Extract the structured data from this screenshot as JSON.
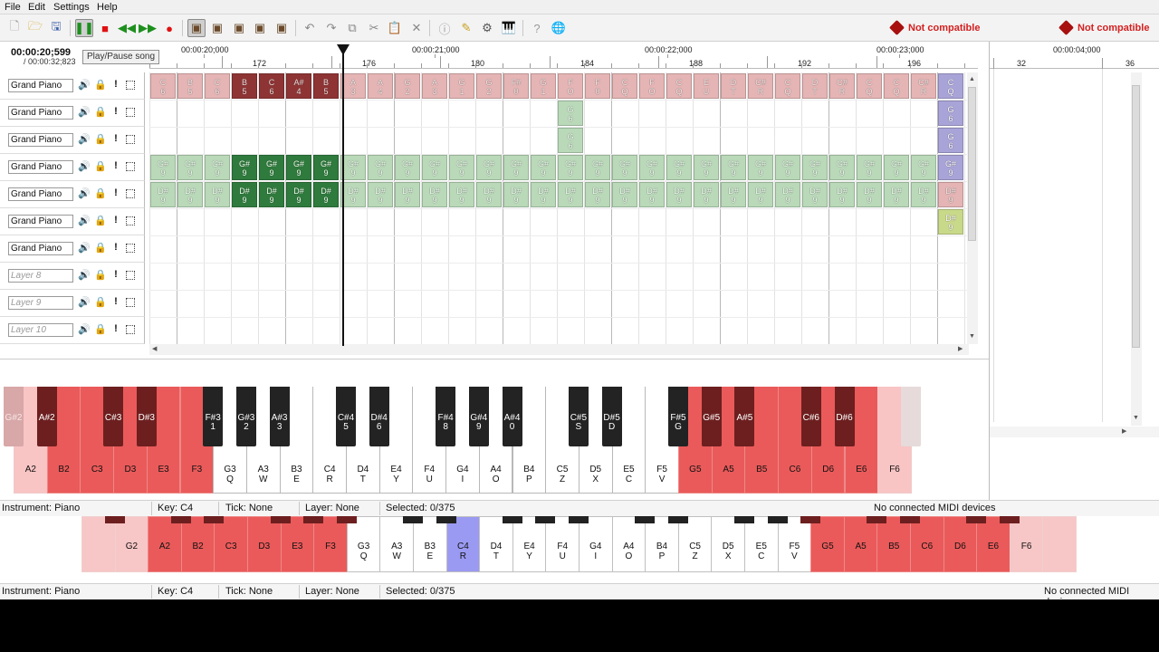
{
  "menu": [
    "File",
    "Edit",
    "Settings",
    "Help"
  ],
  "toolbar": {
    "not_compatible": "Not compatible",
    "tooltip": "Play/Pause song"
  },
  "time": {
    "current": "00:00:20;599",
    "total": "/ 00:00:32;823"
  },
  "ruler": {
    "times": [
      "00:00:20;000",
      "00:00:21;000",
      "00:00:22;000",
      "00:00:23;000"
    ],
    "ticks": [
      "172",
      "176",
      "180",
      "184",
      "188",
      "192",
      "196"
    ],
    "right_time": "00:00:04;000",
    "right_ticks": [
      "32",
      "36"
    ]
  },
  "layers": [
    {
      "name": "Grand Piano",
      "dim": false
    },
    {
      "name": "Grand Piano",
      "dim": false
    },
    {
      "name": "Grand Piano",
      "dim": false
    },
    {
      "name": "Grand Piano",
      "dim": false
    },
    {
      "name": "Grand Piano",
      "dim": false
    },
    {
      "name": "Grand Piano",
      "dim": false
    },
    {
      "name": "Grand Piano",
      "dim": false
    },
    {
      "name": "Layer 8",
      "dim": true
    },
    {
      "name": "Layer 9",
      "dim": true
    },
    {
      "name": "Layer 10",
      "dim": true
    }
  ],
  "notes_row1": [
    [
      "C",
      "6"
    ],
    [
      "B",
      "5"
    ],
    [
      "C",
      "6"
    ],
    [
      "B",
      "5"
    ],
    [
      "C",
      "6"
    ],
    [
      "A#",
      "4"
    ],
    [
      "B",
      "5"
    ],
    [
      "A",
      "3"
    ],
    [
      "A",
      "4"
    ],
    [
      "G",
      "2"
    ],
    [
      "A",
      "3"
    ],
    [
      "G",
      "1"
    ],
    [
      "G",
      "2"
    ],
    [
      "F#",
      "0"
    ],
    [
      "G",
      "1"
    ],
    [
      "F",
      "O"
    ],
    [
      "F",
      "0"
    ],
    [
      "C",
      "Q"
    ],
    [
      "F",
      "O"
    ],
    [
      "C",
      "Q"
    ],
    [
      "E",
      "U"
    ],
    [
      "D",
      "T"
    ],
    [
      "C#",
      "R"
    ],
    [
      "C",
      "Q"
    ],
    [
      "D",
      "T"
    ],
    [
      "C#",
      "R"
    ],
    [
      "C",
      "Q"
    ],
    [
      "C",
      "Q"
    ],
    [
      "C#",
      "R"
    ],
    [
      "C",
      "Q"
    ]
  ],
  "notes_row2_label": [
    "G",
    "6"
  ],
  "notes_row4_label": [
    "G#",
    "9"
  ],
  "notes_row5_label": [
    "D#",
    "9"
  ],
  "status1": {
    "instrument": "Instrument: Piano",
    "key": "Key: C4",
    "tick": "Tick: None",
    "layer": "Layer: None",
    "selected": "Selected: 0/375",
    "midi": "No connected MIDI devices"
  },
  "status2": {
    "instrument": "Instrument: Piano",
    "key": "Key: C4",
    "tick": "Tick: None",
    "layer": "Layer: None",
    "selected": "Selected: 0/375",
    "midi": "No connected MIDI devices"
  },
  "piano_white": [
    {
      "n": "A2",
      "k": "",
      "s": "ltred"
    },
    {
      "n": "B2",
      "k": "",
      "s": "red"
    },
    {
      "n": "C3",
      "k": "",
      "s": "red"
    },
    {
      "n": "D3",
      "k": "",
      "s": "red"
    },
    {
      "n": "E3",
      "k": "",
      "s": "red"
    },
    {
      "n": "F3",
      "k": "",
      "s": "red"
    },
    {
      "n": "G3",
      "k": "Q",
      "s": "white"
    },
    {
      "n": "A3",
      "k": "W",
      "s": "white"
    },
    {
      "n": "B3",
      "k": "E",
      "s": "white"
    },
    {
      "n": "C4",
      "k": "R",
      "s": "white"
    },
    {
      "n": "D4",
      "k": "T",
      "s": "white"
    },
    {
      "n": "E4",
      "k": "Y",
      "s": "white"
    },
    {
      "n": "F4",
      "k": "U",
      "s": "white"
    },
    {
      "n": "G4",
      "k": "I",
      "s": "white"
    },
    {
      "n": "A4",
      "k": "O",
      "s": "white"
    },
    {
      "n": "B4",
      "k": "P",
      "s": "white"
    },
    {
      "n": "C5",
      "k": "Z",
      "s": "white"
    },
    {
      "n": "D5",
      "k": "X",
      "s": "white"
    },
    {
      "n": "E5",
      "k": "C",
      "s": "white"
    },
    {
      "n": "F5",
      "k": "V",
      "s": "white"
    },
    {
      "n": "G5",
      "k": "",
      "s": "red"
    },
    {
      "n": "A5",
      "k": "",
      "s": "red"
    },
    {
      "n": "B5",
      "k": "",
      "s": "red"
    },
    {
      "n": "C6",
      "k": "",
      "s": "red"
    },
    {
      "n": "D6",
      "k": "",
      "s": "red"
    },
    {
      "n": "E6",
      "k": "",
      "s": "red"
    },
    {
      "n": "F6",
      "k": "",
      "s": "ltred"
    }
  ],
  "piano_black": [
    {
      "n": "G#2",
      "k": "",
      "s": "ltred",
      "after": -1
    },
    {
      "n": "A#2",
      "k": "",
      "s": "red",
      "after": 0
    },
    {
      "n": "C#3",
      "k": "",
      "s": "red",
      "after": 2
    },
    {
      "n": "D#3",
      "k": "",
      "s": "red",
      "after": 3
    },
    {
      "n": "F#3",
      "k": "1",
      "s": "black",
      "after": 5
    },
    {
      "n": "G#3",
      "k": "2",
      "s": "black",
      "after": 6
    },
    {
      "n": "A#3",
      "k": "3",
      "s": "black",
      "after": 7
    },
    {
      "n": "C#4",
      "k": "5",
      "s": "black",
      "after": 9
    },
    {
      "n": "D#4",
      "k": "6",
      "s": "black",
      "after": 10
    },
    {
      "n": "F#4",
      "k": "8",
      "s": "black",
      "after": 12
    },
    {
      "n": "G#4",
      "k": "9",
      "s": "black",
      "after": 13
    },
    {
      "n": "A#4",
      "k": "0",
      "s": "black",
      "after": 14
    },
    {
      "n": "C#5",
      "k": "S",
      "s": "black",
      "after": 16
    },
    {
      "n": "D#5",
      "k": "D",
      "s": "black",
      "after": 17
    },
    {
      "n": "F#5",
      "k": "G",
      "s": "black",
      "after": 19
    },
    {
      "n": "G#5",
      "k": "",
      "s": "red",
      "after": 20
    },
    {
      "n": "A#5",
      "k": "",
      "s": "red",
      "after": 21
    },
    {
      "n": "C#6",
      "k": "",
      "s": "red",
      "after": 23
    },
    {
      "n": "D#6",
      "k": "",
      "s": "red",
      "after": 24
    },
    {
      "n": "",
      "k": "",
      "s": "ghost",
      "after": 26
    }
  ],
  "piano2_white": [
    {
      "n": "",
      "k": "",
      "s": "ltred"
    },
    {
      "n": "G2",
      "k": "",
      "s": "ltred"
    },
    {
      "n": "A2",
      "k": "",
      "s": "red"
    },
    {
      "n": "B2",
      "k": "",
      "s": "red"
    },
    {
      "n": "C3",
      "k": "",
      "s": "red"
    },
    {
      "n": "D3",
      "k": "",
      "s": "red"
    },
    {
      "n": "E3",
      "k": "",
      "s": "red"
    },
    {
      "n": "F3",
      "k": "",
      "s": "red"
    },
    {
      "n": "G3",
      "k": "Q",
      "s": "white"
    },
    {
      "n": "A3",
      "k": "W",
      "s": "white"
    },
    {
      "n": "B3",
      "k": "E",
      "s": "white"
    },
    {
      "n": "C4",
      "k": "R",
      "s": "sel"
    },
    {
      "n": "D4",
      "k": "T",
      "s": "white"
    },
    {
      "n": "E4",
      "k": "Y",
      "s": "white"
    },
    {
      "n": "F4",
      "k": "U",
      "s": "white"
    },
    {
      "n": "G4",
      "k": "I",
      "s": "white"
    },
    {
      "n": "A4",
      "k": "O",
      "s": "white"
    },
    {
      "n": "B4",
      "k": "P",
      "s": "white"
    },
    {
      "n": "C5",
      "k": "Z",
      "s": "white"
    },
    {
      "n": "D5",
      "k": "X",
      "s": "white"
    },
    {
      "n": "E5",
      "k": "C",
      "s": "white"
    },
    {
      "n": "F5",
      "k": "V",
      "s": "white"
    },
    {
      "n": "G5",
      "k": "",
      "s": "red"
    },
    {
      "n": "A5",
      "k": "",
      "s": "red"
    },
    {
      "n": "B5",
      "k": "",
      "s": "red"
    },
    {
      "n": "C6",
      "k": "",
      "s": "red"
    },
    {
      "n": "D6",
      "k": "",
      "s": "red"
    },
    {
      "n": "E6",
      "k": "",
      "s": "red"
    },
    {
      "n": "F6",
      "k": "",
      "s": "ltred"
    },
    {
      "n": "",
      "k": "",
      "s": "ltred"
    }
  ]
}
